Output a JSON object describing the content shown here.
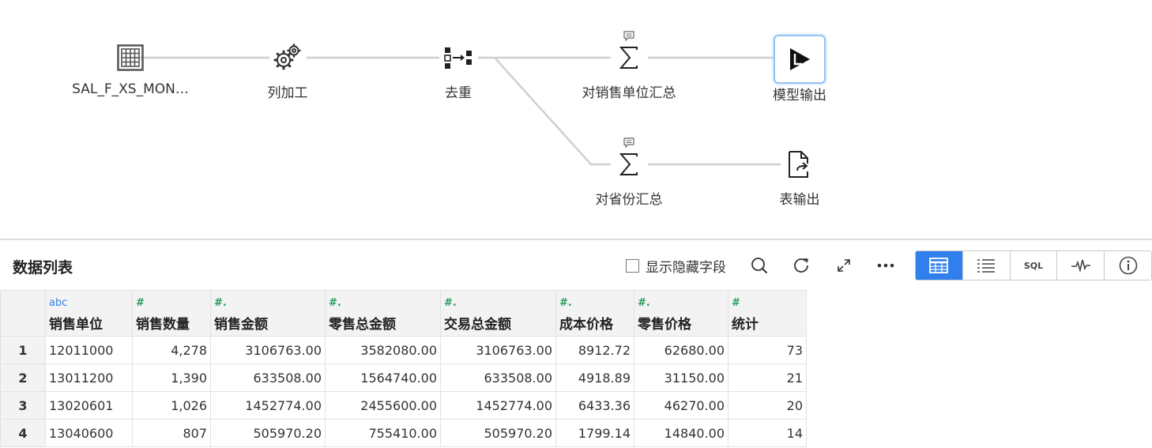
{
  "flow": {
    "nodes": [
      {
        "id": "source",
        "label": "SAL_F_XS_MON…",
        "icon": "table-grid-icon"
      },
      {
        "id": "calc",
        "label": "列加工",
        "icon": "gears-icon"
      },
      {
        "id": "dedup",
        "label": "去重",
        "icon": "dedup-icon"
      },
      {
        "id": "agg_unit",
        "label": "对销售单位汇总",
        "icon": "sigma-icon"
      },
      {
        "id": "model_out",
        "label": "模型输出",
        "icon": "play-output-icon",
        "selected": true
      },
      {
        "id": "agg_prov",
        "label": "对省份汇总",
        "icon": "sigma-icon"
      },
      {
        "id": "table_out",
        "label": "表输出",
        "icon": "file-export-icon"
      }
    ]
  },
  "panel": {
    "title": "数据列表",
    "show_hidden_label": "显示隐藏字段",
    "show_hidden_checked": false,
    "tools": [
      "search-icon",
      "refresh-icon",
      "expand-icon",
      "more-icon"
    ],
    "views": [
      {
        "name": "table-view",
        "active": true
      },
      {
        "name": "list-view",
        "active": false
      },
      {
        "name": "sql-view",
        "label": "SQL",
        "active": false
      },
      {
        "name": "profile-view",
        "active": false
      },
      {
        "name": "info-view",
        "active": false
      }
    ]
  },
  "table": {
    "columns": [
      {
        "type_tag": "abc",
        "type": "str",
        "name": "销售单位"
      },
      {
        "type_tag": "#",
        "type": "num",
        "name": "销售数量"
      },
      {
        "type_tag": "#.",
        "type": "num",
        "name": "销售金额"
      },
      {
        "type_tag": "#.",
        "type": "num",
        "name": "零售总金额"
      },
      {
        "type_tag": "#.",
        "type": "num",
        "name": "交易总金额"
      },
      {
        "type_tag": "#.",
        "type": "num",
        "name": "成本价格"
      },
      {
        "type_tag": "#.",
        "type": "num",
        "name": "零售价格"
      },
      {
        "type_tag": "#",
        "type": "num",
        "name": "统计"
      }
    ],
    "rows": [
      {
        "n": "1",
        "cells": [
          "12011000",
          "4,278",
          "3106763.00",
          "3582080.00",
          "3106763.00",
          "8912.72",
          "62680.00",
          "73"
        ]
      },
      {
        "n": "2",
        "cells": [
          "13011200",
          "1,390",
          "633508.00",
          "1564740.00",
          "633508.00",
          "4918.89",
          "31150.00",
          "21"
        ]
      },
      {
        "n": "3",
        "cells": [
          "13020601",
          "1,026",
          "1452774.00",
          "2455600.00",
          "1452774.00",
          "6433.36",
          "46270.00",
          "20"
        ]
      },
      {
        "n": "4",
        "cells": [
          "13040600",
          "807",
          "505970.20",
          "755410.00",
          "505970.20",
          "1799.14",
          "14840.00",
          "14"
        ]
      }
    ]
  },
  "colors": {
    "accent": "#2f80ed",
    "edge": "#cfcfcf",
    "num_tag": "#2a9d5c"
  }
}
